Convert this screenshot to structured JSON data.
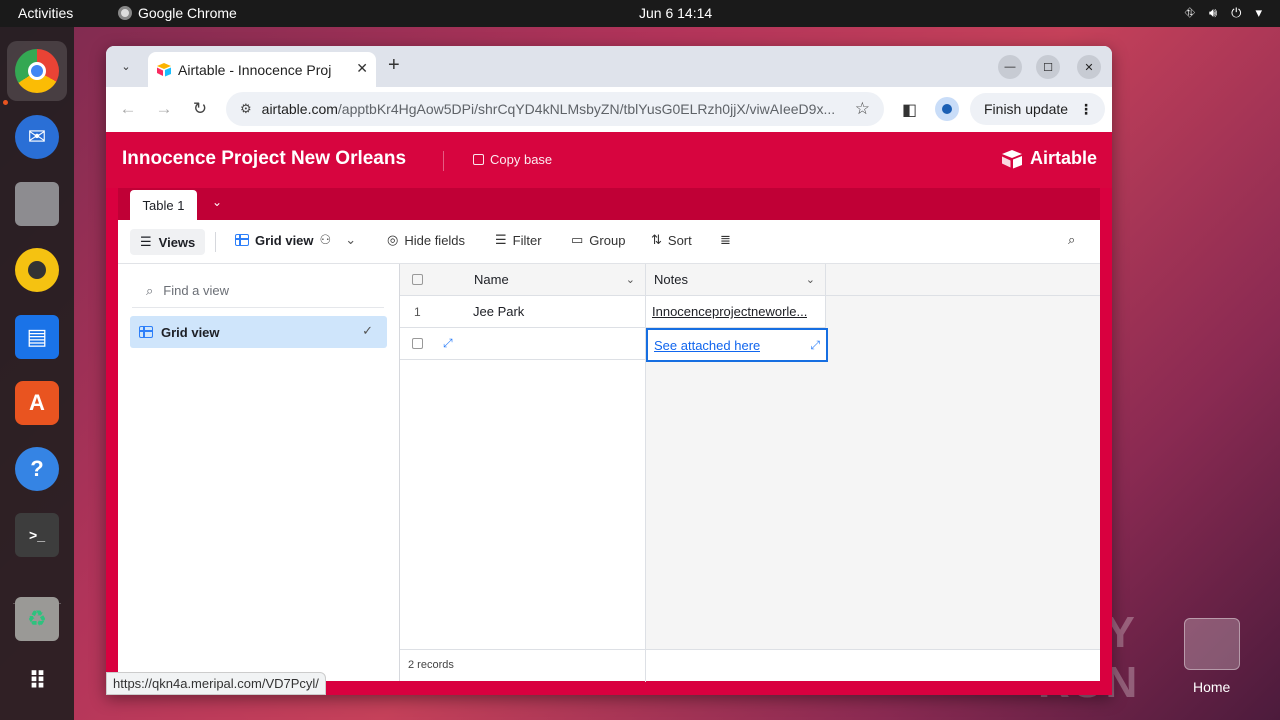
{
  "topbar": {
    "activities": "Activities",
    "app_name": "Google Chrome",
    "clock": "Jun 6  14:14"
  },
  "dock": {
    "items": [
      {
        "name": "chrome",
        "color": "#4285f4"
      },
      {
        "name": "thunderbird",
        "color": "#2a6fd6"
      },
      {
        "name": "files",
        "color": "#77767b"
      },
      {
        "name": "rhythmbox",
        "color": "#f5c211"
      },
      {
        "name": "writer",
        "color": "#1a73e8"
      },
      {
        "name": "app-center",
        "color": "#e95420"
      },
      {
        "name": "help",
        "color": "#3584e4"
      },
      {
        "name": "terminal",
        "color": "#3d3d3d"
      },
      {
        "name": "trash",
        "color": "#9a9996"
      },
      {
        "name": "app-grid",
        "color": "#ffffff"
      }
    ]
  },
  "watermark": {
    "text": "ANY RUN",
    "home_label": "Home"
  },
  "browser": {
    "tab_title": "Airtable - Innocence Proj",
    "url_host": "airtable.com",
    "url_path": "/apptbKr4HgAow5DPi/shrCqYD4kNLMsbyZN/tblYusG0ELRzh0jjX/viwAIeeD9x...",
    "finish_update": "Finish update",
    "status_url": "https://qkn4a.meripal.com/VD7Pcyl/"
  },
  "airtable": {
    "base_title": "Innocence Project New Orleans",
    "copy_base": "Copy base",
    "logo": "Airtable",
    "table_tab": "Table 1",
    "toolbar": {
      "views": "Views",
      "grid_view": "Grid view",
      "hide_fields": "Hide fields",
      "filter": "Filter",
      "group": "Group",
      "sort": "Sort"
    },
    "sidebar": {
      "find_placeholder": "Find a view",
      "view_item": "Grid view"
    },
    "grid": {
      "columns": [
        "Name",
        "Notes"
      ],
      "rows": [
        {
          "num": "1",
          "name": "Jee Park",
          "notes": "Innocenceprojectneworle..."
        },
        {
          "num": "",
          "name": "",
          "notes": "See attached here"
        }
      ],
      "records_count": "2 records"
    }
  }
}
